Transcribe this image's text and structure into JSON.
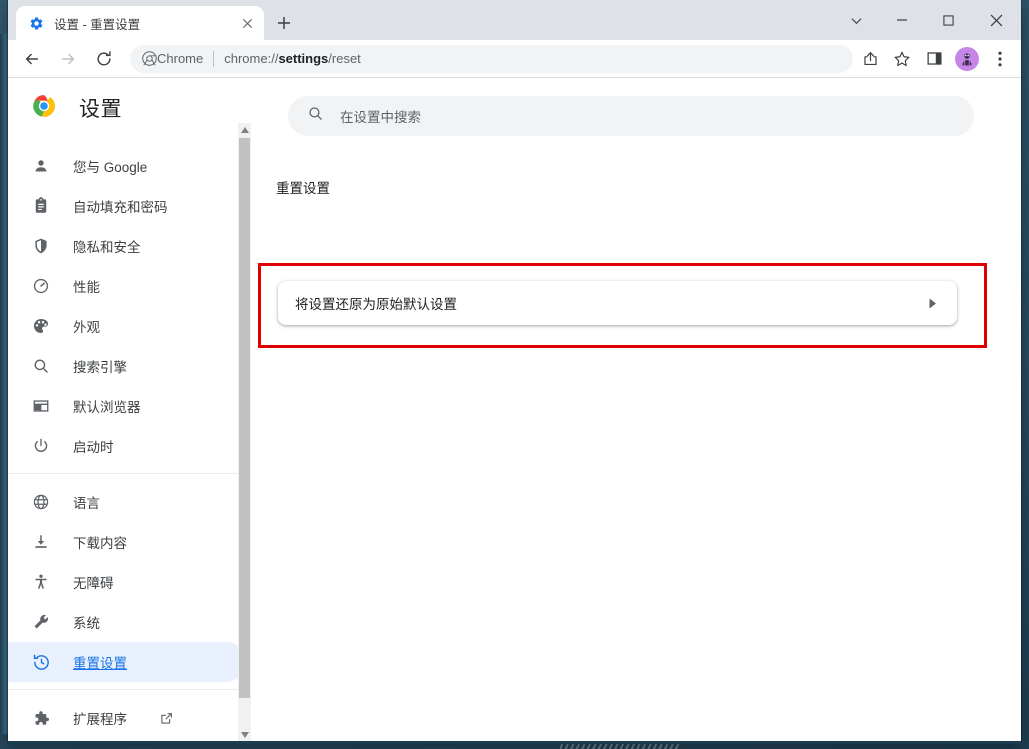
{
  "window": {
    "controls": {
      "tab_search": "tab-search-chevron",
      "minimize": "minimize",
      "maximize": "maximize",
      "close": "close"
    }
  },
  "tabstrip": {
    "tab": {
      "favicon": "settings-gear-icon",
      "title": "设置 - 重置设置",
      "close_label": "×"
    },
    "new_tab_label": "+"
  },
  "toolbar": {
    "back": "back-arrow",
    "forward": "forward-arrow",
    "reload": "reload",
    "omnibox": {
      "chip_icon": "chrome-logo",
      "chip_label": "Chrome",
      "url_prefix": "chrome://",
      "url_bold": "settings",
      "url_suffix": "/reset",
      "url_full": "chrome://settings/reset"
    },
    "share": "share-icon",
    "bookmark": "star-icon",
    "side_panel": "side-panel-icon",
    "profile": "profile-avatar",
    "menu": "three-dot-menu-icon"
  },
  "sidebar": {
    "brand": {
      "logo": "chrome-logo",
      "title": "设置"
    },
    "groups": [
      {
        "items": [
          {
            "icon": "person-icon",
            "label": "您与 Google",
            "selected": false
          },
          {
            "icon": "clipboard-icon",
            "label": "自动填充和密码",
            "selected": false
          },
          {
            "icon": "shield-icon",
            "label": "隐私和安全",
            "selected": false
          },
          {
            "icon": "gauge-icon",
            "label": "性能",
            "selected": false
          },
          {
            "icon": "palette-icon",
            "label": "外观",
            "selected": false
          },
          {
            "icon": "search-icon",
            "label": "搜索引擎",
            "selected": false
          },
          {
            "icon": "browser-window-icon",
            "label": "默认浏览器",
            "selected": false
          },
          {
            "icon": "power-icon",
            "label": "启动时",
            "selected": false
          }
        ]
      },
      {
        "items": [
          {
            "icon": "globe-icon",
            "label": "语言",
            "selected": false
          },
          {
            "icon": "download-icon",
            "label": "下载内容",
            "selected": false
          },
          {
            "icon": "accessibility-icon",
            "label": "无障碍",
            "selected": false
          },
          {
            "icon": "wrench-icon",
            "label": "系统",
            "selected": false
          },
          {
            "icon": "reset-clock-icon",
            "label": "重置设置",
            "selected": true
          }
        ]
      },
      {
        "items": [
          {
            "icon": "puzzle-icon",
            "label": "扩展程序",
            "selected": false,
            "external": true
          }
        ]
      }
    ],
    "scrollbar": {
      "up_arrow": "▲",
      "down_arrow": "▼"
    }
  },
  "main": {
    "search": {
      "icon": "search-icon",
      "placeholder": "在设置中搜索",
      "value": ""
    },
    "section_title": "重置设置",
    "card": {
      "label": "将设置还原为原始默认设置",
      "arrow": "chevron-right-icon"
    },
    "highlight_color": "#e00000"
  },
  "colors": {
    "accent_blue": "#1a73e8",
    "selected_bg": "#e8f0fe",
    "toolbar_bg": "#dee1e6",
    "field_bg": "#f1f3f4",
    "highlight_red": "#e00000",
    "avatar_purple": "#c586e8"
  }
}
